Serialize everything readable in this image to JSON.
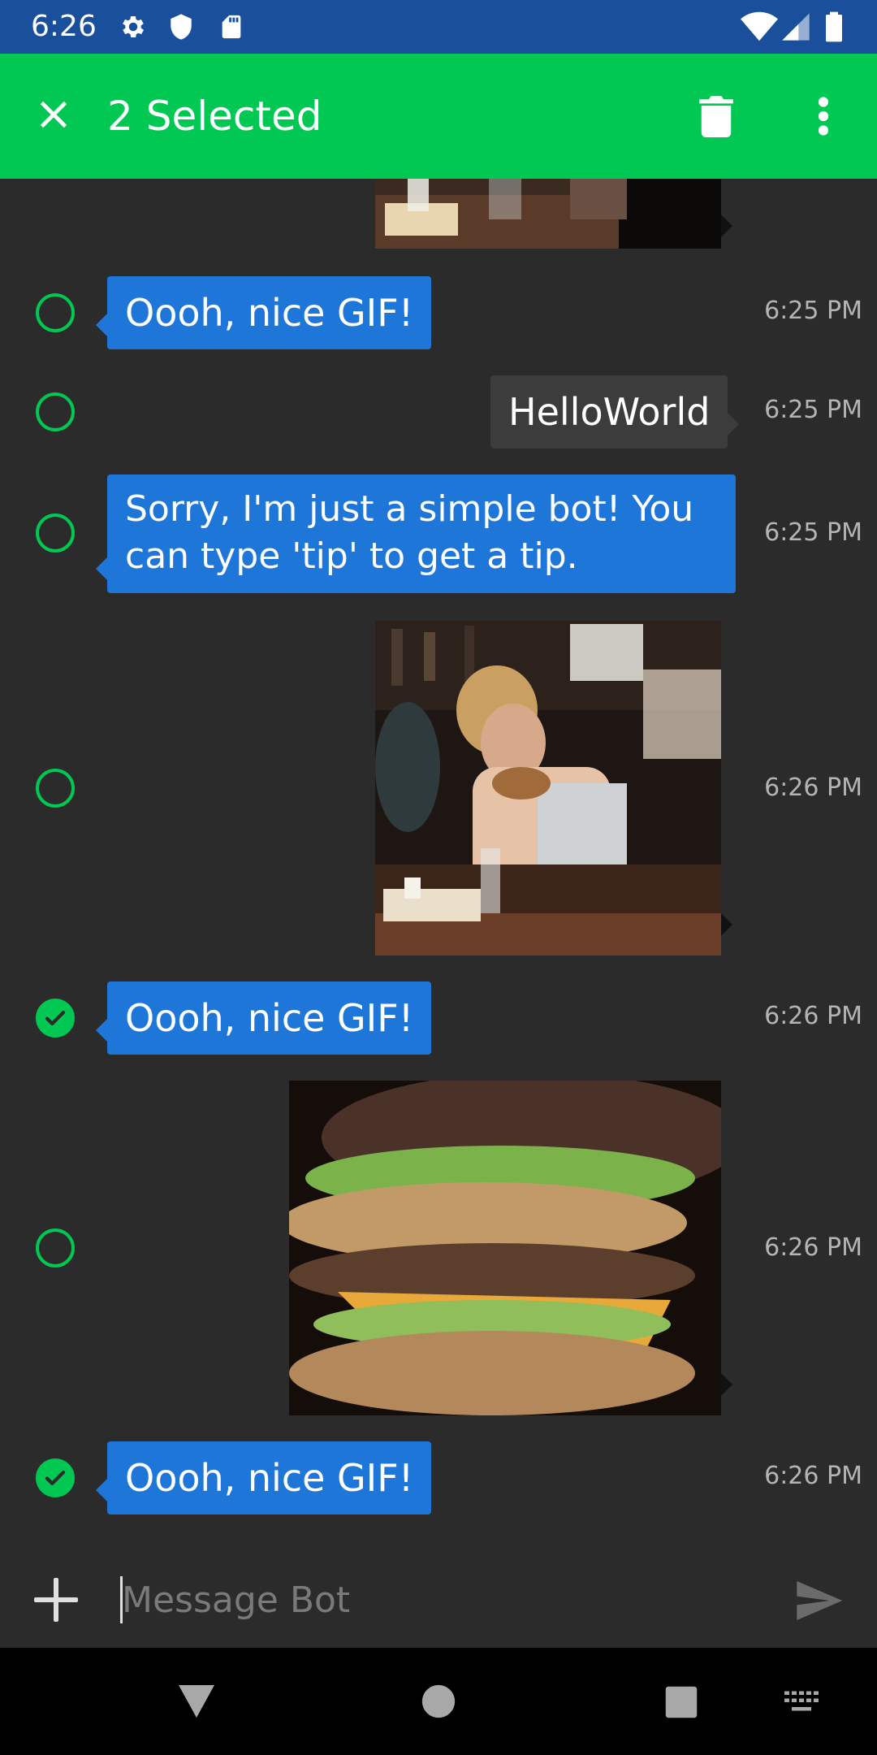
{
  "status_bar": {
    "time": "6:26",
    "icons": [
      "gear-icon",
      "shield-icon",
      "sd-card-icon",
      "wifi-icon",
      "signal-icon",
      "battery-icon"
    ]
  },
  "action_bar": {
    "title": "2 Selected",
    "icons": [
      "close-icon",
      "delete-icon",
      "more-vert-icon"
    ],
    "color": "#00c853"
  },
  "messages": [
    {
      "type": "gif",
      "from": "user",
      "time": "",
      "selected": false,
      "partial": true
    },
    {
      "type": "text",
      "from": "bot",
      "text": "Oooh, nice GIF!",
      "time": "6:25 PM",
      "selected": false
    },
    {
      "type": "text",
      "from": "user",
      "text": "HelloWorld",
      "time": "6:25 PM",
      "selected": false
    },
    {
      "type": "text",
      "from": "bot",
      "text": "Sorry, I'm just a simple bot! You can type 'tip' to get a tip.",
      "time": "6:25 PM",
      "selected": false
    },
    {
      "type": "gif",
      "from": "user",
      "time": "6:26 PM",
      "selected": false
    },
    {
      "type": "text",
      "from": "bot",
      "text": "Oooh, nice GIF!",
      "time": "6:26 PM",
      "selected": true
    },
    {
      "type": "gif",
      "from": "user",
      "time": "6:26 PM",
      "selected": false
    },
    {
      "type": "text",
      "from": "bot",
      "text": "Oooh, nice GIF!",
      "time": "6:26 PM",
      "selected": true
    }
  ],
  "composer": {
    "placeholder": "Message Bot",
    "value": ""
  },
  "colors": {
    "bot_bubble": "#1e77d8",
    "user_bubble": "#3c3c3c",
    "status_bar": "#1a4f9c",
    "chat_background": "#2b2b2b"
  }
}
